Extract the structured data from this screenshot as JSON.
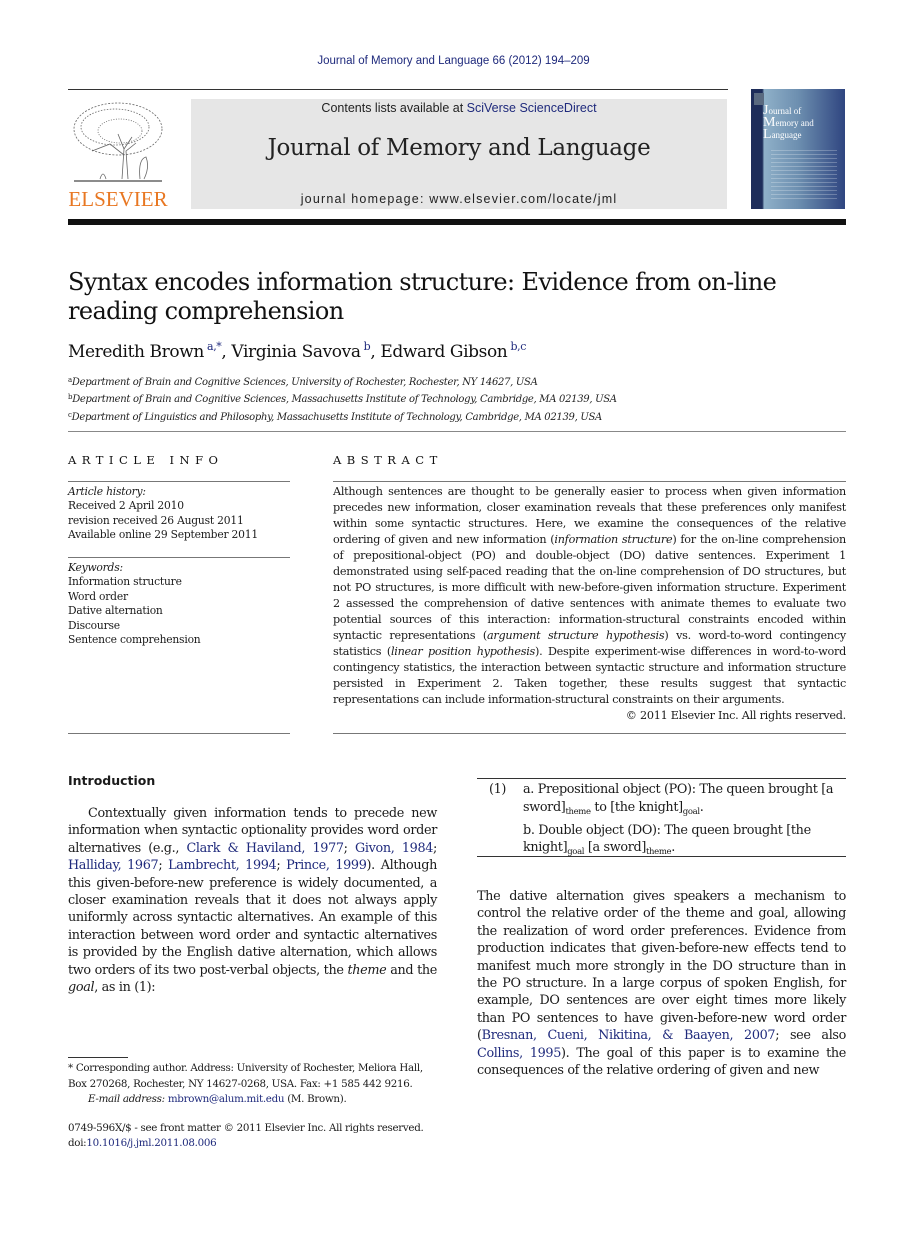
{
  "running_head": "Journal of Memory and Language 66 (2012) 194–209",
  "masthead": {
    "publisher_logo_text": "ELSEVIER",
    "contents_prefix": "Contents lists available at ",
    "contents_link": "SciVerse ScienceDirect",
    "journal_name": "Journal of Memory and Language",
    "homepage_line": "journal homepage: www.elsevier.com/locate/jml",
    "cover": {
      "line1_initial": "J",
      "line1_rest": "ournal of",
      "line2_initial": "M",
      "line2_rest": "emory and",
      "line3_initial": "L",
      "line3_rest": "anguage"
    }
  },
  "article": {
    "title": "Syntax encodes information structure: Evidence from on-line reading comprehension",
    "authors": [
      {
        "name": "Meredith Brown",
        "affil": "a,*"
      },
      {
        "name": "Virginia Savova",
        "affil": "b"
      },
      {
        "name": "Edward Gibson",
        "affil": "b,c"
      }
    ],
    "affiliations": [
      {
        "key": "a",
        "text": "Department of Brain and Cognitive Sciences, University of Rochester, Rochester, NY 14627, USA"
      },
      {
        "key": "b",
        "text": "Department of Brain and Cognitive Sciences, Massachusetts Institute of Technology, Cambridge, MA 02139, USA"
      },
      {
        "key": "c",
        "text": "Department of Linguistics and Philosophy, Massachusetts Institute of Technology, Cambridge, MA 02139, USA"
      }
    ]
  },
  "article_info": {
    "heading": "ARTICLE INFO",
    "history_label": "Article history:",
    "history": [
      "Received 2 April 2010",
      "revision received 26 August 2011",
      "Available online 29 September 2011"
    ],
    "keywords_label": "Keywords:",
    "keywords": [
      "Information structure",
      "Word order",
      "Dative alternation",
      "Discourse",
      "Sentence comprehension"
    ]
  },
  "abstract": {
    "heading": "ABSTRACT",
    "part1": "Although sentences are thought to be generally easier to process when given information precedes new information, closer examination reveals that these preferences only manifest within some syntactic structures. Here, we examine the consequences of the relative ordering of given and new information (",
    "ital1": "information structure",
    "part2": ") for the on-line comprehension of prepositional-object (PO) and double-object (DO) dative sentences. Experiment 1 demonstrated using self-paced reading that the on-line comprehension of DO structures, but not PO structures, is more difficult with new-before-given information structure. Experiment 2 assessed the comprehension of dative sentences with animate themes to evaluate two potential sources of this interaction: information-structural constraints encoded within syntactic representations (",
    "ital2": "argument structure hypothesis",
    "part3": ") vs. word-to-word contingency statistics (",
    "ital3": "linear position hypothesis",
    "part4": "). Despite experiment-wise differences in word-to-word contingency statistics, the interaction between syntactic structure and information structure persisted in Experiment 2. Taken together, these results suggest that syntactic representations can include information-structural constraints on their arguments.",
    "copyright": "© 2011 Elsevier Inc. All rights reserved."
  },
  "introduction": {
    "heading": "Introduction",
    "p1_a": "Contextually given information tends to precede new information when syntactic optionality provides word order alternatives (e.g., ",
    "p1_cites": [
      "Clark & Haviland, 1977",
      "Givon, 1984",
      "Halliday, 1967",
      "Lambrecht, 1994",
      "Prince, 1999"
    ],
    "p1_b": "). Although this given-before-new preference is widely documented, a closer examination reveals that it does not always apply uniformly across syntactic alternatives. An example of this interaction between word order and syntactic alternatives is provided by the English dative alternation, which allows two orders of its two post-verbal objects, the ",
    "p1_theme": "theme",
    "p1_c": " and the ",
    "p1_goal": "goal",
    "p1_d": ", as in (1):"
  },
  "example": {
    "number": "(1)",
    "a_text1": "a. Prepositional object (PO): The queen brought [a sword]",
    "a_sub1": "theme",
    "a_text2": " to [the knight]",
    "a_sub2": "goal",
    "a_end": ".",
    "b_text1": "b. Double object (DO): The queen brought [the knight]",
    "b_sub1": "goal",
    "b_text2": " [a sword]",
    "b_sub2": "theme",
    "b_end": "."
  },
  "right_para": {
    "text_a": "The dative alternation gives speakers a mechanism to control the relative order of the theme and goal, allowing the realization of word order preferences. Evidence from production indicates that given-before-new effects tend to manifest much more strongly in the DO structure than in the PO structure. In a large corpus of spoken English, for example, DO sentences are over eight times more likely than PO sentences to have given-before-new word order (",
    "cite1": "Bresnan, Cueni, Nikitina, & Baayen, 2007",
    "text_b": "; see also ",
    "cite2": "Collins, 1995",
    "text_c": "). The goal of this paper is to examine the consequences of the relative ordering of given and new"
  },
  "footnote": {
    "corresponding": "* Corresponding author. Address: University of Rochester, Meliora Hall, Box 270268, Rochester, NY 14627-0268, USA. Fax: +1 585 442 9216.",
    "email_label": "E-mail address: ",
    "email": "mbrown@alum.mit.edu",
    "email_suffix": " (M. Brown)."
  },
  "front_matter": {
    "issn_line": "0749-596X/$ - see front matter © 2011 Elsevier Inc. All rights reserved.",
    "doi_label": "doi:",
    "doi": "10.1016/j.jml.2011.08.006"
  }
}
